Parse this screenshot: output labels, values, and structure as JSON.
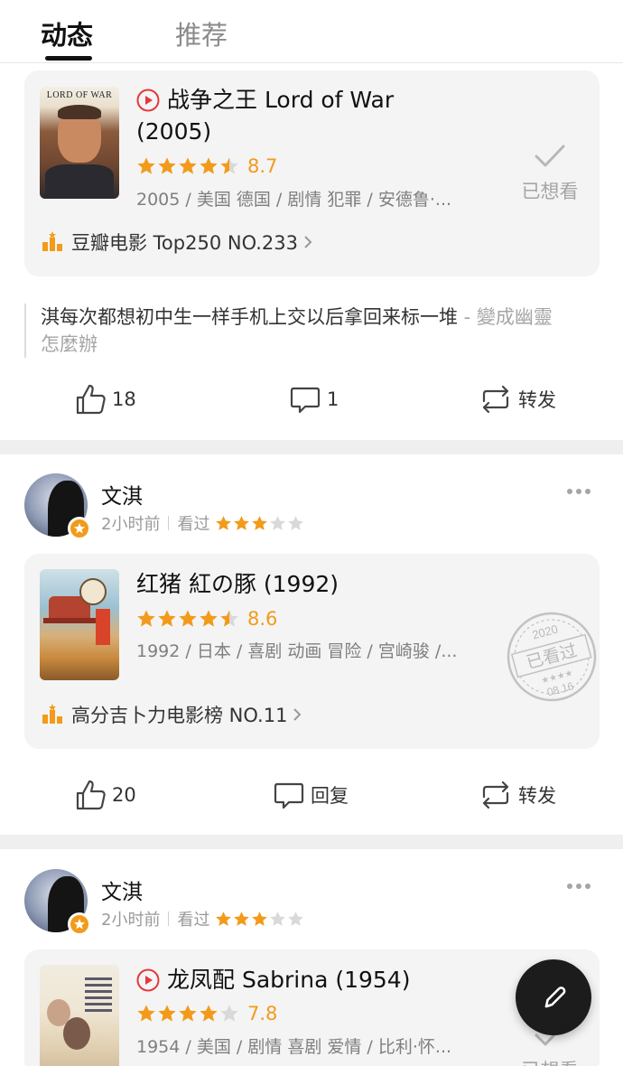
{
  "tabs": {
    "active": "动态",
    "inactive": "推荐"
  },
  "post1": {
    "movie": {
      "title": "战争之王 Lord of War (2005)",
      "score": "8.7",
      "stars": 4.5,
      "meta": "2005 / 美国 德国 / 剧情 犯罪 / 安德鲁·...",
      "ranking": "豆瓣电影 Top250 NO.233",
      "poster_caption": "LORD OF WAR",
      "want_label": "已想看"
    },
    "quote": "淇每次都想初中生一样手机上交以后拿回来标一堆",
    "quote_author": " - 變成幽靈怎麼辦",
    "actions": {
      "likes": "18",
      "comments": "1",
      "share": "转发"
    }
  },
  "post2": {
    "user": {
      "name": "文淇",
      "time": "2小时前",
      "status": "看过",
      "rating": 3
    },
    "movie": {
      "title": "红猪 紅の豚 (1992)",
      "score": "8.6",
      "stars": 4.5,
      "meta": "1992 / 日本 / 喜剧 动画 冒险 / 宫崎骏 /...",
      "ranking": "高分吉卜力电影榜 NO.11"
    },
    "stamp": {
      "year": "2020",
      "label": "已看过",
      "date": "08.16"
    },
    "actions": {
      "likes": "20",
      "comments": "回复",
      "share": "转发"
    }
  },
  "post3": {
    "user": {
      "name": "文淇",
      "time": "2小时前",
      "status": "看过",
      "rating": 3
    },
    "movie": {
      "title": "龙凤配 Sabrina (1954)",
      "score": "7.8",
      "stars": 4,
      "meta": "1954 / 美国 / 剧情 喜剧 爱情 / 比利·怀...",
      "want_label": "已想看"
    }
  },
  "colors": {
    "accent": "#f29b1a",
    "play": "#e4393c",
    "fab": "#1c1c1c"
  },
  "icons": [
    "play-icon",
    "ranking-icon",
    "check-icon",
    "like-icon",
    "comment-icon",
    "share-icon",
    "more-icon",
    "badge-icon",
    "pen-icon"
  ]
}
